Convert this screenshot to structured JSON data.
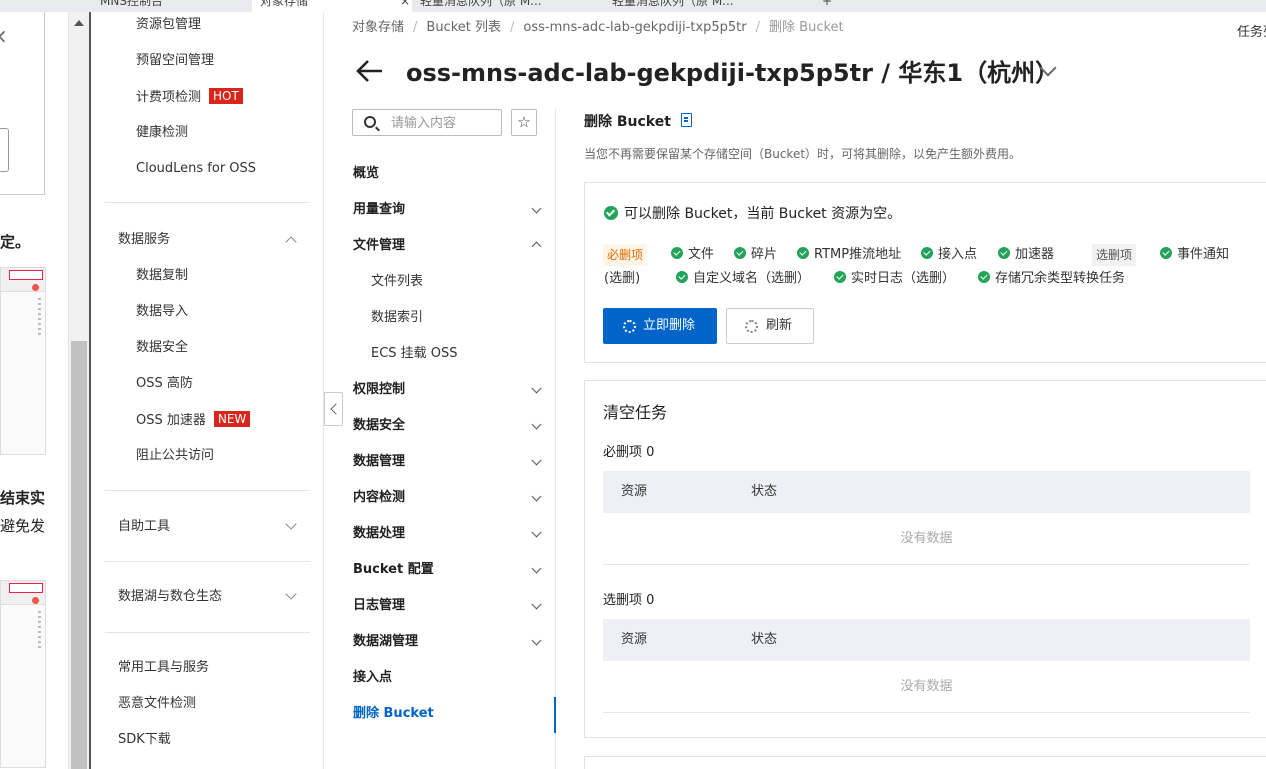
{
  "browser_tabs": [
    "MNS控制台",
    "对象存储",
    "×",
    "轻量消息队列（原 M...",
    "轻量消息队列（原 M...",
    "+"
  ],
  "doc_panel": {
    "close": "×",
    "text1": "定。",
    "text2": "结束实",
    "text3": "避免发"
  },
  "sidebar": {
    "top_items": [
      "资源包管理",
      "预留空间管理",
      "计费项检测",
      "健康检测",
      "CloudLens for OSS"
    ],
    "hot_badge": "HOT",
    "data_services": {
      "label": "数据服务",
      "items": [
        "数据复制",
        "数据导入",
        "数据安全",
        "OSS 高防",
        "OSS 加速器",
        "阻止公共访问"
      ]
    },
    "new_badge": "NEW",
    "self_tools": "自助工具",
    "data_lake": "数据湖与数仓生态",
    "bottom_items": [
      "常用工具与服务",
      "恶意文件检测",
      "SDK下载"
    ]
  },
  "breadcrumb": [
    "对象存储",
    "Bucket 列表",
    "oss-mns-adc-lab-gekpdiji-txp5p5tr",
    "删除 Bucket"
  ],
  "task_link": "任务列",
  "page_title": "oss-mns-adc-lab-gekpdiji-txp5p5tr / 华东1（杭州）",
  "search": {
    "placeholder": "请输入内容"
  },
  "bucket_nav": {
    "overview": "概览",
    "usage": "用量查询",
    "file_mgmt": "文件管理",
    "file_list": "文件列表",
    "data_index": "数据索引",
    "ecs_mount": "ECS 挂载 OSS",
    "permission": "权限控制",
    "data_security": "数据安全",
    "data_mgmt": "数据管理",
    "content_check": "内容检测",
    "data_process": "数据处理",
    "bucket_config": "Bucket 配置",
    "log_mgmt": "日志管理",
    "data_lake_mgmt": "数据湖管理",
    "access_point": "接入点",
    "delete_bucket": "删除 Bucket"
  },
  "content": {
    "title": "删除 Bucket",
    "desc": "当您不再需要保留某个存储空间（Bucket）时，可将其删除，以免产生额外费用。",
    "status_msg": "可以删除 Bucket，当前 Bucket 资源为空。",
    "required_tag": "必删项",
    "optional_tag": "选删项",
    "required_checks": [
      "文件",
      "碎片",
      "RTMP推流地址",
      "接入点",
      "加速器"
    ],
    "optional_checks": [
      "事件通知",
      "(选删)",
      "自定义域名（选删）",
      "实时日志（选删）",
      "存储冗余类型转换任务"
    ],
    "delete_button": "立即删除",
    "refresh_button": "刷新",
    "clear_task": {
      "title": "清空任务",
      "required_label": "必删项 0",
      "optional_label": "选删项 0",
      "col_resource": "资源",
      "col_status": "状态",
      "empty": "没有数据"
    }
  },
  "colors": {
    "primary": "#0064c8",
    "success": "#23a35a",
    "badge_red": "#d9261c",
    "required_tag": "#e06c00"
  }
}
